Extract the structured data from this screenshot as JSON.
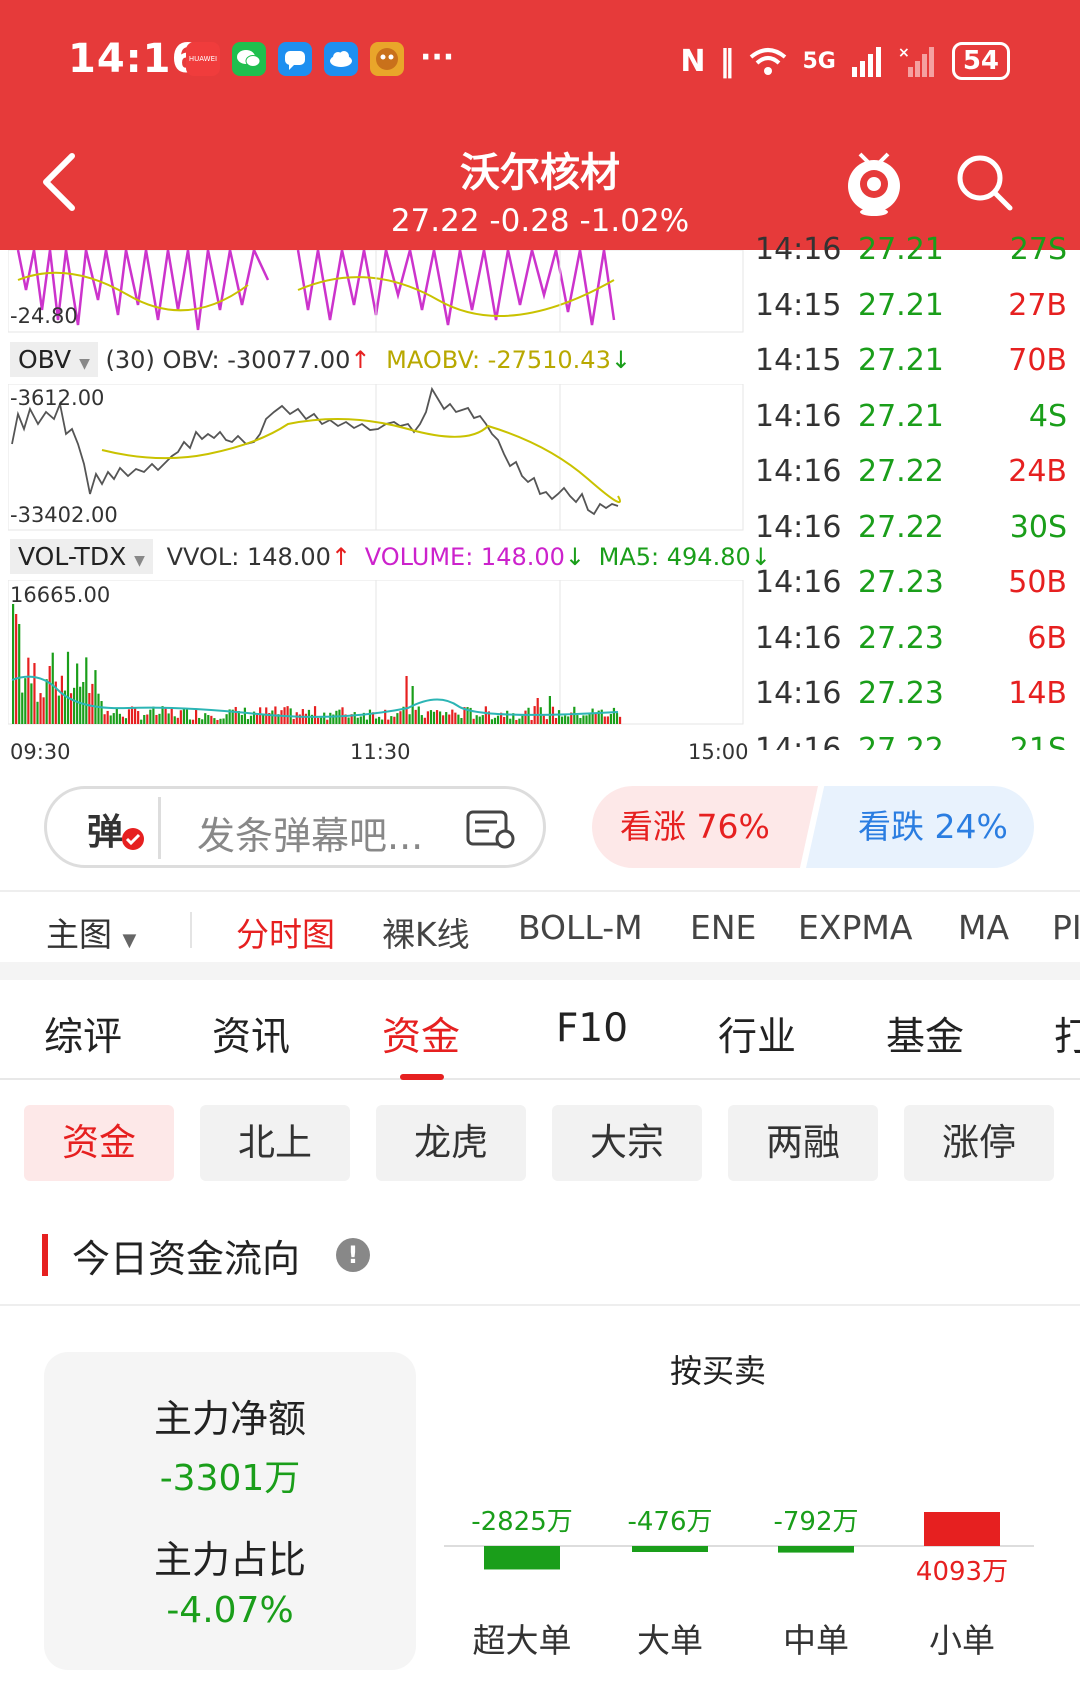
{
  "status_bar": {
    "time": "14:16",
    "apps": [
      "huawei-app",
      "wechat-app",
      "messages-app",
      "cloud-app",
      "game-app"
    ],
    "more": "···",
    "nfc": "N",
    "vibrate": "‖",
    "network": "5G",
    "battery": "54"
  },
  "header": {
    "title": "沃尔核材",
    "price_line": "27.22 -0.28 -1.02%"
  },
  "indicators": {
    "lower_label": "-24.80",
    "obv": {
      "name": "OBV",
      "text_params": "(30) OBV: -30077.00",
      "obv_arrow": "↑",
      "text_ma": "MAOBV: -27510.43",
      "ma_arrow": "↓",
      "top": "-3612.00",
      "bottom": "-33402.00"
    },
    "vol": {
      "name": "VOL-TDX",
      "vvol": "VVOL: 148.00",
      "vvol_arrow": "↑",
      "volume": "VOLUME: 148.00",
      "volume_arrow": "↓",
      "ma5": "MA5: 494.80",
      "ma5_arrow": "↓",
      "top": "16665.00"
    },
    "time_axis": [
      "09:30",
      "11:30",
      "15:00"
    ]
  },
  "ticks": [
    {
      "time": "14:16",
      "price": "27.21",
      "vol": "27S",
      "side": "S"
    },
    {
      "time": "14:15",
      "price": "27.21",
      "vol": "27B",
      "side": "B"
    },
    {
      "time": "14:15",
      "price": "27.21",
      "vol": "70B",
      "side": "B"
    },
    {
      "time": "14:16",
      "price": "27.21",
      "vol": "4S",
      "side": "S"
    },
    {
      "time": "14:16",
      "price": "27.22",
      "vol": "24B",
      "side": "B"
    },
    {
      "time": "14:16",
      "price": "27.22",
      "vol": "30S",
      "side": "S"
    },
    {
      "time": "14:16",
      "price": "27.23",
      "vol": "50B",
      "side": "B"
    },
    {
      "time": "14:16",
      "price": "27.23",
      "vol": "6B",
      "side": "B"
    },
    {
      "time": "14:16",
      "price": "27.23",
      "vol": "14B",
      "side": "B"
    },
    {
      "time": "14:16",
      "price": "27.22",
      "vol": "21S",
      "side": "S"
    }
  ],
  "danmu": {
    "icon_label": "弹",
    "placeholder": "发条弹幕吧..."
  },
  "vote": {
    "up": "看涨 76%",
    "down": "看跌 24%"
  },
  "chart_tabs": {
    "main": "主图",
    "items": [
      "分时图",
      "裸K线",
      "BOLL-M",
      "ENE",
      "EXPMA",
      "MA",
      "PI"
    ],
    "active": "分时图"
  },
  "section_tabs": {
    "items": [
      "综评",
      "资讯",
      "资金",
      "F10",
      "行业",
      "基金",
      "打"
    ],
    "active": "资金"
  },
  "sub_tabs": {
    "items": [
      "资金",
      "北上",
      "龙虎",
      "大宗",
      "两融",
      "涨停"
    ],
    "active": "资金"
  },
  "section": {
    "title": "今日资金流向",
    "info_icon": "!"
  },
  "summary": {
    "net_label": "主力净额",
    "net_value": "-3301万",
    "ratio_label": "主力占比",
    "ratio_value": "-4.07%"
  },
  "flow_chart_title": "按买卖",
  "colors": {
    "brand_red": "#e63a3a",
    "up_red": "#e62020",
    "down_green": "#1a9e1a",
    "blue": "#2a7de1"
  },
  "chart_data": {
    "type": "bar",
    "title": "按买卖",
    "categories": [
      "超大单",
      "大单",
      "中单",
      "小单"
    ],
    "values": [
      -2825,
      -476,
      -792,
      4093
    ],
    "labels": [
      "-2825万",
      "-476万",
      "-792万",
      "4093万"
    ],
    "unit": "万"
  }
}
